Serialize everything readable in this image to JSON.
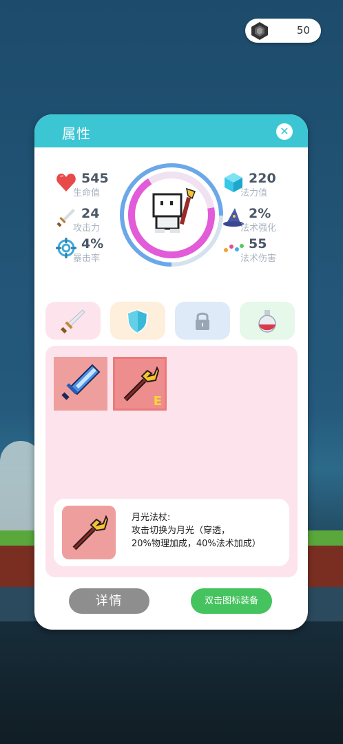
{
  "currency": {
    "icon": "hexagon-gem-icon",
    "amount": "50"
  },
  "panel": {
    "title": "属性",
    "close_icon": "close-icon",
    "accent_color": "#3cc6d4"
  },
  "stats_left": [
    {
      "icon": "heart-icon",
      "value": "545",
      "label": "生命值"
    },
    {
      "icon": "sword-icon",
      "value": "24",
      "label": "攻击力"
    },
    {
      "icon": "crosshair-icon",
      "value": "4%",
      "label": "暴击率"
    }
  ],
  "stats_right": [
    {
      "icon": "mana-crystal-icon",
      "value": "220",
      "label": "法力值"
    },
    {
      "icon": "wizard-hat-icon",
      "value": "2%",
      "label": "法术强化"
    },
    {
      "icon": "magic-dots-icon",
      "value": "55",
      "label": "法术伤害"
    }
  ],
  "tabs": [
    {
      "icon": "sword-icon",
      "color": "#fde4ec"
    },
    {
      "icon": "shield-icon",
      "color": "#fdefdc"
    },
    {
      "icon": "lock-icon",
      "color": "#dfeaf8"
    },
    {
      "icon": "potion-icon",
      "color": "#e5f8ea"
    }
  ],
  "inventory": {
    "items": [
      {
        "icon": "blue-sword-icon",
        "equipped": false
      },
      {
        "icon": "moonlight-staff-icon",
        "equipped": true,
        "equip_mark": "E"
      }
    ]
  },
  "description": {
    "icon": "moonlight-staff-icon",
    "line1": "月光法杖:",
    "line2": "攻击切换为月光（穿透，",
    "line3": "20%物理加成，40%法术加成）"
  },
  "buttons": {
    "detail": "详情",
    "equip_hint": "双击图标装备"
  }
}
